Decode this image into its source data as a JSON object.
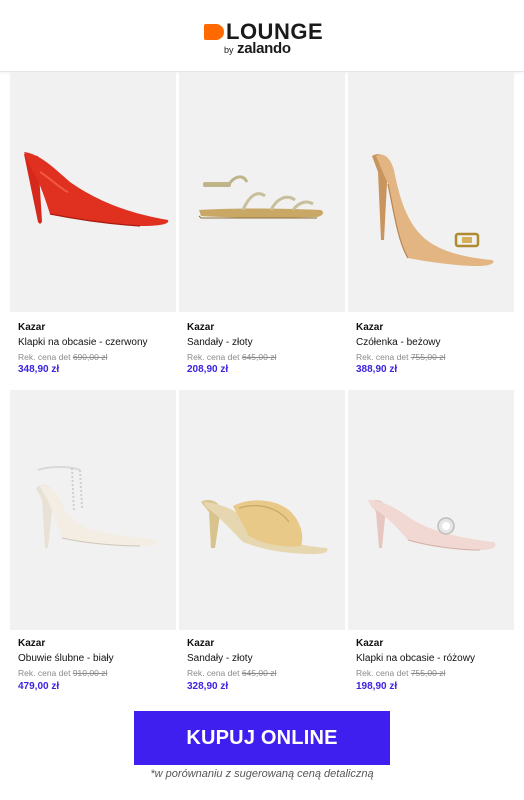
{
  "header": {
    "logo_word": "LOUNGE",
    "logo_by": "by",
    "logo_zalando": "zalando",
    "accent": "#ff6900"
  },
  "products": [
    {
      "brand": "Kazar",
      "name": "Klapki na obcasie - czerwony",
      "rrp_label": "Rek. cena det",
      "rrp_old": "690,00 zł",
      "price": "348,90 zł",
      "icon": "red-mule-heel"
    },
    {
      "brand": "Kazar",
      "name": "Sandały - złoty",
      "rrp_label": "Rek. cena det",
      "rrp_old": "645,00 zł",
      "price": "208,90 zł",
      "icon": "gold-flat-sandal"
    },
    {
      "brand": "Kazar",
      "name": "Czółenka - beżowy",
      "rrp_label": "Rek. cena det",
      "rrp_old": "755,00 zł",
      "price": "388,90 zł",
      "icon": "beige-pump"
    },
    {
      "brand": "Kazar",
      "name": "Obuwie ślubne - biały",
      "rrp_label": "Rek. cena det",
      "rrp_old": "910,00 zł",
      "price": "479,00 zł",
      "icon": "white-bridal-heel"
    },
    {
      "brand": "Kazar",
      "name": "Sandały - złoty",
      "rrp_label": "Rek. cena det",
      "rrp_old": "645,00 zł",
      "price": "328,90 zł",
      "icon": "gold-heeled-mule"
    },
    {
      "brand": "Kazar",
      "name": "Klapki na obcasie - różowy",
      "rrp_label": "Rek. cena det",
      "rrp_old": "755,00 zł",
      "price": "198,90 zł",
      "icon": "pink-mule-heel"
    }
  ],
  "cta": {
    "label": "KUPUJ ONLINE",
    "color": "#3f1ef0"
  },
  "footnote": "*w porównaniu z sugerowaną ceną detaliczną",
  "price_color": "#3b23e0"
}
